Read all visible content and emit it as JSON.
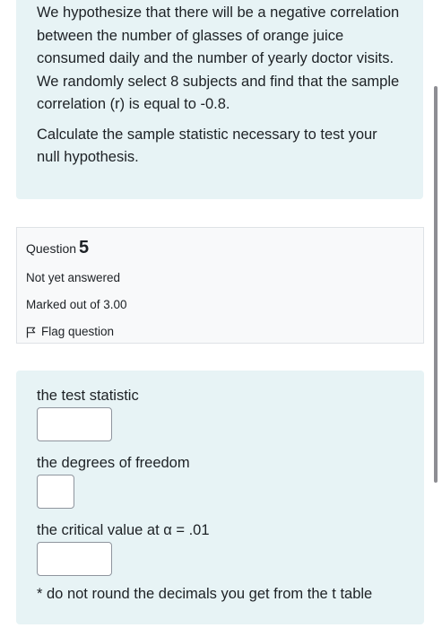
{
  "question_text": {
    "paragraph1": "We hypothesize that there will be a negative correlation between the number of glasses of orange juice consumed daily and the number of yearly doctor visits. We randomly select 8 subjects and find that the sample correlation (r) is equal to -0.8.",
    "paragraph2": "Calculate the sample statistic necessary to test your null hypothesis."
  },
  "question_info": {
    "question_label": "Question",
    "question_number": "5",
    "status": "Not yet answered",
    "marks": "Marked out of 3.00",
    "flag_label": "Flag question"
  },
  "answers": {
    "test_statistic_label": "the test statistic",
    "test_statistic_value": "",
    "degrees_of_freedom_label": "the degrees of freedom",
    "degrees_of_freedom_value": "",
    "critical_value_label": "the critical value at α = .01",
    "critical_value_value": "",
    "note": "* do not round the decimals you get from the t table"
  },
  "colors": {
    "panel_background": "#e7f3f5",
    "info_background": "#f8f9fa",
    "info_border": "#dee2e6",
    "text": "#1d2125"
  }
}
